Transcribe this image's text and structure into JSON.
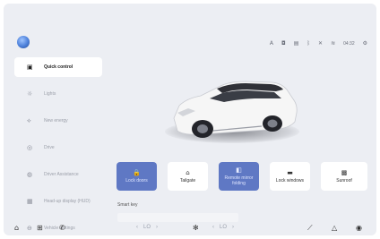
{
  "status": {
    "time": "04:32",
    "icons": [
      "display-icon",
      "camera-icon",
      "grid-icon",
      "bluetooth-icon",
      "no-signal-icon",
      "wifi-icon",
      "settings-icon"
    ],
    "glyphs": [
      "A",
      "◘",
      "▤",
      "ᛒ",
      "✕",
      "≋",
      "⚙"
    ]
  },
  "sidebar": {
    "items": [
      {
        "label": "Quick control",
        "glyph": "▣"
      },
      {
        "label": "Lights",
        "glyph": "☼"
      },
      {
        "label": "New energy",
        "glyph": "⟡"
      },
      {
        "label": "Drive",
        "glyph": "◎"
      },
      {
        "label": "Driver Assistance",
        "glyph": "◍"
      },
      {
        "label": "Head-up display (HUD)",
        "glyph": "▦"
      },
      {
        "label": "Vehicle settings",
        "glyph": "⊖"
      }
    ]
  },
  "controls": {
    "tiles": [
      {
        "label": "Lock doors",
        "glyph": "🔒",
        "active": true
      },
      {
        "label": "Tailgate",
        "glyph": "⌂",
        "active": false
      },
      {
        "label": "Remote mirror folding",
        "glyph": "◧",
        "active": true
      },
      {
        "label": "Lock windows",
        "glyph": "▬",
        "active": false
      },
      {
        "label": "Sunroof",
        "glyph": "▩",
        "active": false
      }
    ]
  },
  "smart_key": {
    "label": "Smart key"
  },
  "dock": {
    "left_icons": [
      "⌂",
      "⊞",
      "✆"
    ],
    "temp_left": [
      "‹",
      "LO",
      "›"
    ],
    "center_icon": "✻",
    "temp_right": [
      "‹",
      "LO",
      "›"
    ],
    "right_icons": [
      "⟋",
      "△",
      "◉"
    ]
  },
  "colors": {
    "accent": "#5f78c4",
    "background": "#eceef3"
  }
}
